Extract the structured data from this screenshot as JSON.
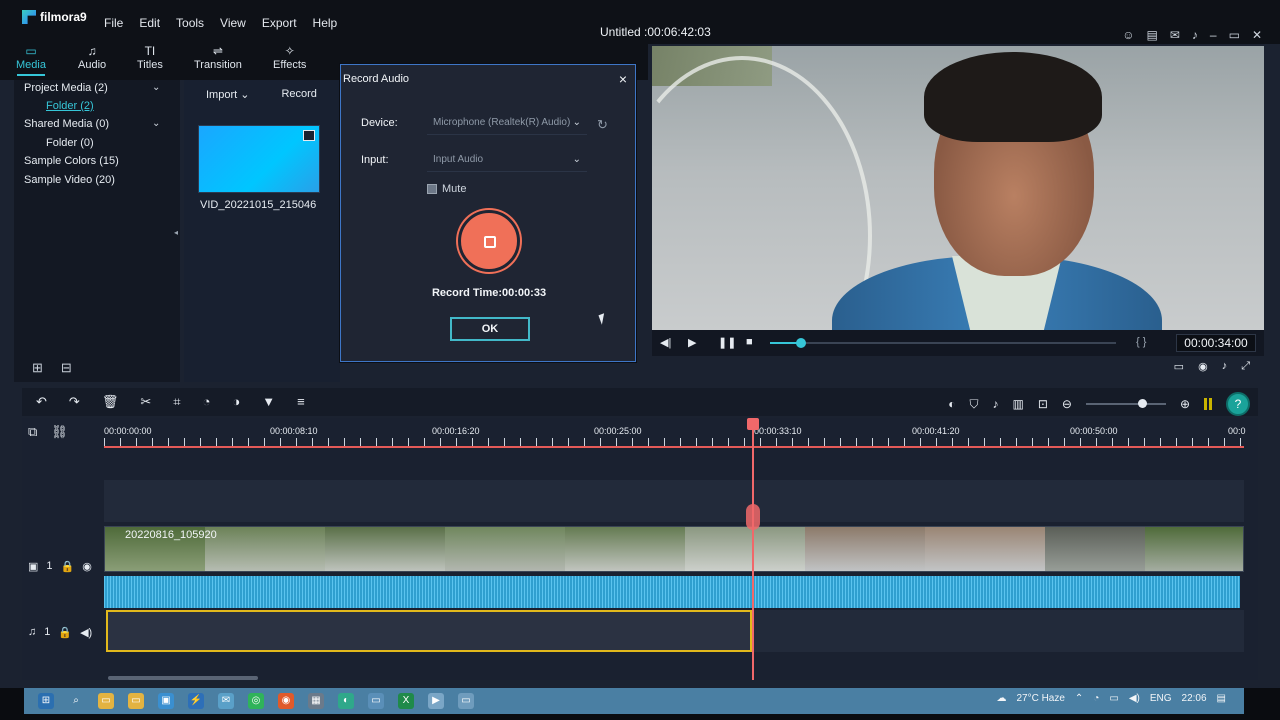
{
  "app": {
    "name": "filmora9",
    "title": "Untitled :00:06:42:03",
    "menu": [
      "File",
      "Edit",
      "Tools",
      "View",
      "Export",
      "Help"
    ]
  },
  "tabs": [
    {
      "label": "Media",
      "icon": "folder-icon",
      "glyph": "▭"
    },
    {
      "label": "Audio",
      "icon": "music-icon",
      "glyph": "♫"
    },
    {
      "label": "Titles",
      "icon": "text-icon",
      "glyph": "TI"
    },
    {
      "label": "Transition",
      "icon": "transition-icon",
      "glyph": "⇌"
    },
    {
      "label": "Effects",
      "icon": "effects-icon",
      "glyph": "✧"
    }
  ],
  "sidebar": {
    "items": [
      {
        "label": "Project Media (2)",
        "chevron": "⌄"
      },
      {
        "label": "Folder (2)",
        "sub": true,
        "active": true
      },
      {
        "label": "Shared Media (0)",
        "chevron": "⌄"
      },
      {
        "label": "Folder (0)",
        "sub": true
      },
      {
        "label": "Sample Colors (15)"
      },
      {
        "label": "Sample Video (20)"
      }
    ]
  },
  "media": {
    "import_label": "Import",
    "record_label": "Record",
    "clip_name": "VID_20221015_215046"
  },
  "dialog": {
    "title": "Record Audio",
    "device_label": "Device:",
    "device_value": "Microphone (Realtek(R) Audio)",
    "input_label": "Input:",
    "input_value": "Input Audio",
    "mute_label": "Mute",
    "record_time": "Record Time:00:00:33",
    "ok_label": "OK",
    "close": "×"
  },
  "preview": {
    "timecode": "00:00:34:00",
    "brackets": "{ }",
    "progress": 0.09
  },
  "timeline": {
    "ruler_ticks": [
      "00:00:00:00",
      "00:00:08:10",
      "00:00:16:20",
      "00:00:25:00",
      "00:00:33:10",
      "00:00:41:20",
      "00:00:50:00",
      "00:0"
    ],
    "video_track_label": "1",
    "audio_track_label": "1",
    "clip_label": "20220816_105920",
    "zoom": 0.7,
    "level_meter_color": "#c9b400"
  },
  "taskbar": {
    "weather": "27°C Haze",
    "language": "ENG",
    "time": "22:06"
  },
  "colors": {
    "accent": "#36c6d8",
    "record": "#f07058",
    "playhead": "#f0686a",
    "audio_selected": "#e2b91c"
  }
}
